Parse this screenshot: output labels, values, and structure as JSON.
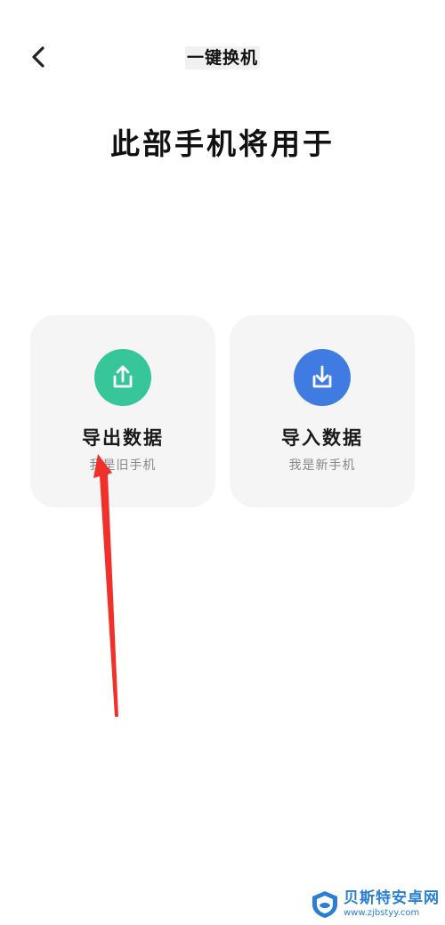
{
  "header": {
    "title": "一键换机",
    "back_icon": "chevron-left-icon"
  },
  "page_title": "此部手机将用于",
  "options": [
    {
      "label": "导出数据",
      "subtitle": "我是旧手机",
      "icon": "upload-share-icon",
      "color": "#36c69a"
    },
    {
      "label": "导入数据",
      "subtitle": "我是新手机",
      "icon": "download-tray-icon",
      "color": "#3f7be0"
    }
  ],
  "annotation": {
    "color": "#f0312b"
  },
  "watermark": {
    "name": "贝斯特安卓网",
    "url": "www.zjbstyy.com",
    "color": "#2a7fd4"
  }
}
